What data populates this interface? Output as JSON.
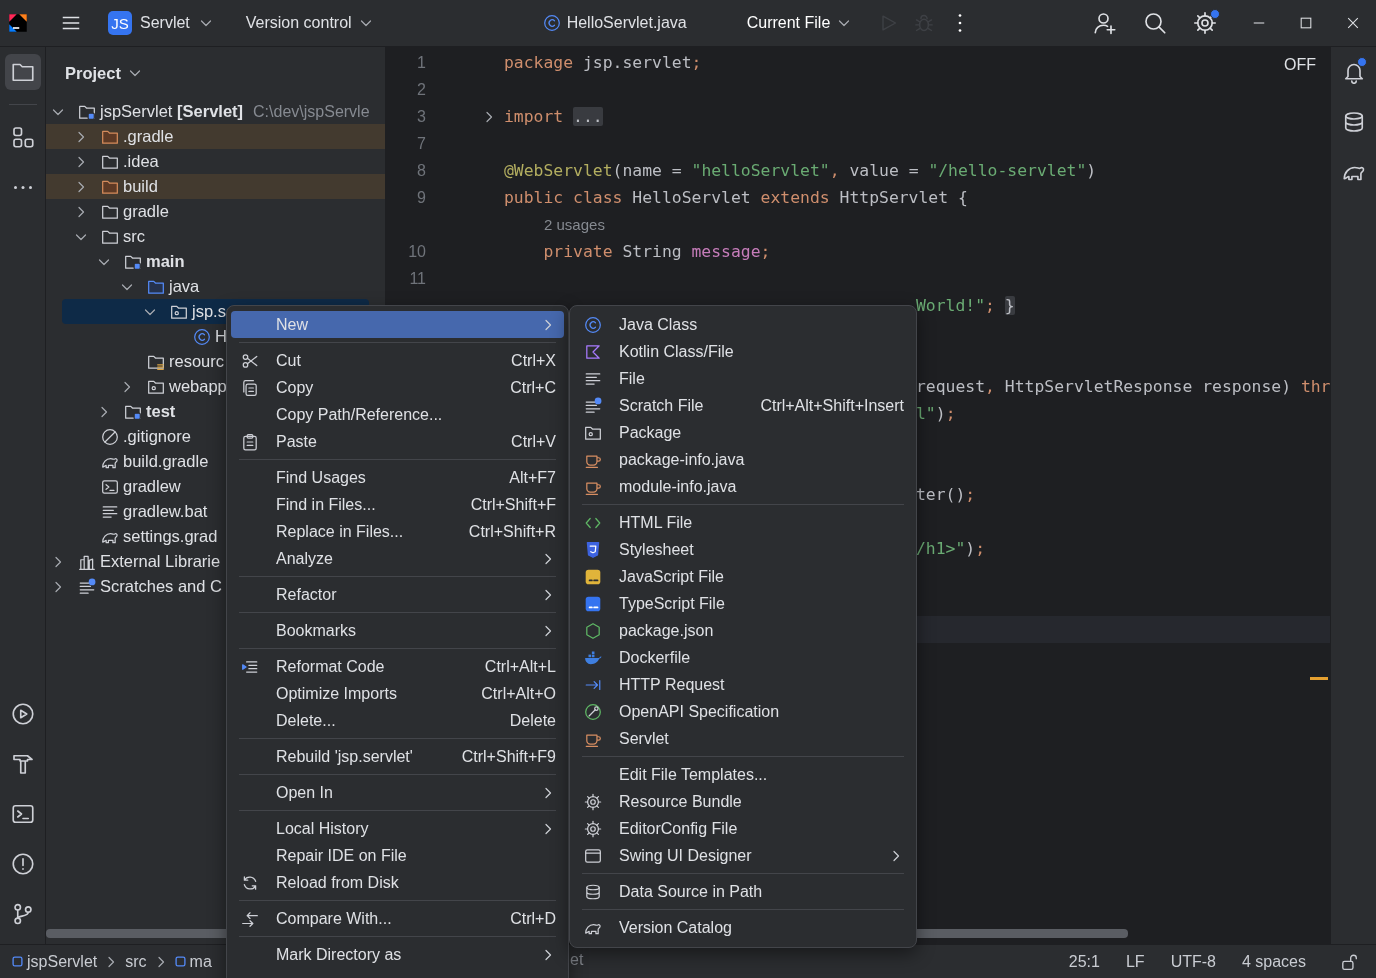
{
  "top_bar": {
    "project": {
      "badge": "JS",
      "name": "Servlet"
    },
    "vcs": "Version control",
    "file": "HelloServlet.java",
    "run_config": "Current File",
    "actions": [
      {
        "kind": "run",
        "disabled": true
      },
      {
        "kind": "debug",
        "disabled": true
      },
      {
        "kind": "more",
        "disabled": false
      }
    ],
    "tools": [
      {
        "kind": "add-user",
        "badge": false
      },
      {
        "kind": "search",
        "badge": false
      },
      {
        "kind": "settings",
        "badge": true
      }
    ]
  },
  "left_strip": {
    "top": [
      {
        "kind": "project",
        "selected": true
      },
      {
        "kind": "structure",
        "selected": false
      },
      {
        "kind": "more",
        "selected": false
      }
    ],
    "bottom": [
      {
        "kind": "services",
        "selected": false
      },
      {
        "kind": "build",
        "selected": false
      },
      {
        "kind": "terminal",
        "selected": false
      },
      {
        "kind": "problems",
        "selected": false
      },
      {
        "kind": "git",
        "selected": false
      }
    ]
  },
  "right_strip": [
    {
      "kind": "notifications",
      "badge": true
    },
    {
      "kind": "database",
      "badge": false
    },
    {
      "kind": "gradle",
      "badge": false
    }
  ],
  "project": {
    "title": "Project",
    "tree": [
      {
        "label": "jspServlet **[Servlet]**",
        "path": "C:\\dev\\jspServle",
        "kind": "module",
        "expanded": true,
        "selected": false,
        "excluded": false,
        "children": [
          {
            "label": ".gradle",
            "kind": "folder",
            "expanded": false,
            "selected": false,
            "excluded": true
          },
          {
            "label": ".idea",
            "kind": "folder",
            "expanded": false,
            "selected": false,
            "excluded": false
          },
          {
            "label": "build",
            "kind": "folder",
            "expanded": false,
            "selected": false,
            "excluded": true
          },
          {
            "label": "gradle",
            "kind": "folder",
            "expanded": false,
            "selected": false,
            "excluded": false
          },
          {
            "label": "src",
            "kind": "folder",
            "expanded": true,
            "selected": false,
            "excluded": false,
            "children": [
              {
                "label": "main",
                "kind": "source-set",
                "expanded": true,
                "selected": false,
                "excluded": false,
                "children": [
                  {
                    "label": "java",
                    "kind": "source-root",
                    "expanded": true,
                    "selected": false,
                    "excluded": false,
                    "children": [
                      {
                        "label": "jsp.s",
                        "kind": "package",
                        "expanded": true,
                        "selected": true,
                        "excluded": false,
                        "children": [
                          {
                            "label": "H",
                            "kind": "class",
                            "selected": false,
                            "excluded": false
                          }
                        ]
                      }
                    ]
                  },
                  {
                    "label": "resourc",
                    "kind": "resources",
                    "selected": false,
                    "excluded": false
                  },
                  {
                    "label": "webapp",
                    "kind": "package",
                    "expanded": false,
                    "selected": false,
                    "excluded": false
                  }
                ]
              },
              {
                "label": "test",
                "kind": "source-set",
                "expanded": false,
                "selected": false,
                "excluded": false
              }
            ]
          },
          {
            "label": ".gitignore",
            "kind": "gitignore",
            "selected": false,
            "excluded": false
          },
          {
            "label": "build.gradle",
            "kind": "gradle",
            "selected": false,
            "excluded": false
          },
          {
            "label": "gradlew",
            "kind": "terminal",
            "selected": false,
            "excluded": false
          },
          {
            "label": "gradlew.bat",
            "kind": "text",
            "selected": false,
            "excluded": false
          },
          {
            "label": "settings.grad",
            "kind": "gradle",
            "selected": false,
            "excluded": false
          }
        ]
      },
      {
        "label": "External Librarie",
        "kind": "library",
        "expanded": false,
        "selected": false,
        "excluded": false
      },
      {
        "label": "Scratches and C",
        "kind": "scratch",
        "expanded": false,
        "selected": false,
        "excluded": false
      }
    ]
  },
  "editor": {
    "mode": "OFF",
    "lines": [
      {
        "kind": "code",
        "number": "1",
        "tokens": [
          {
            "text": "package",
            "kind": "keyword"
          },
          {
            "text": " jsp.servlet",
            "kind": "plain"
          },
          {
            "text": ";",
            "kind": "keyword"
          }
        ]
      },
      {
        "kind": "code",
        "number": "2"
      },
      {
        "kind": "code",
        "number": "3",
        "folded": true,
        "tokens": [
          {
            "text": "import ",
            "kind": "keyword"
          },
          {
            "text": "...",
            "kind": "folded"
          }
        ]
      },
      {
        "kind": "code",
        "number": "7"
      },
      {
        "kind": "code",
        "number": "8",
        "tokens": [
          {
            "text": "@WebServlet",
            "kind": "annotation"
          },
          {
            "text": "(name = ",
            "kind": "plain"
          },
          {
            "text": "\"helloServlet\"",
            "kind": "string"
          },
          {
            "text": ", ",
            "kind": "keyword"
          },
          {
            "text": "value = ",
            "kind": "plain"
          },
          {
            "text": "\"/hello-servlet\"",
            "kind": "string"
          },
          {
            "text": ")",
            "kind": "plain"
          }
        ]
      },
      {
        "kind": "code",
        "number": "9",
        "tokens": [
          {
            "text": "public class ",
            "kind": "keyword"
          },
          {
            "text": "HelloServlet ",
            "kind": "plain"
          },
          {
            "text": "extends ",
            "kind": "keyword"
          },
          {
            "text": "HttpServlet {",
            "kind": "plain"
          }
        ]
      },
      {
        "kind": "hint",
        "text": "2 usages"
      },
      {
        "kind": "code",
        "number": "10",
        "tokens": [
          {
            "text": "    private ",
            "kind": "keyword"
          },
          {
            "text": "String ",
            "kind": "plain"
          },
          {
            "text": "message",
            "kind": "field"
          },
          {
            "text": ";",
            "kind": "keyword"
          }
        ]
      },
      {
        "kind": "code",
        "number": "11"
      },
      {
        "kind": "fragment",
        "tokens": [
          {
            "text": "World!\"",
            "kind": "string"
          },
          {
            "text": "; ",
            "kind": "keyword"
          },
          {
            "text": "}",
            "kind": "folded"
          }
        ]
      },
      {
        "kind": "covered"
      },
      {
        "kind": "covered"
      },
      {
        "kind": "fragment",
        "tokens": [
          {
            "text": "request",
            "kind": "plain"
          },
          {
            "text": ", ",
            "kind": "keyword"
          },
          {
            "text": "HttpServletResponse response) ",
            "kind": "plain"
          },
          {
            "text": "thr",
            "kind": "keyword"
          }
        ]
      },
      {
        "kind": "fragment",
        "tokens": [
          {
            "text": "l\"",
            "kind": "string"
          },
          {
            "text": ")",
            "kind": "plain"
          },
          {
            "text": ";",
            "kind": "keyword"
          }
        ]
      },
      {
        "kind": "covered"
      },
      {
        "kind": "covered"
      },
      {
        "kind": "fragment",
        "tokens": [
          {
            "text": "ter()",
            "kind": "plain"
          },
          {
            "text": ";",
            "kind": "keyword"
          }
        ]
      },
      {
        "kind": "covered"
      },
      {
        "kind": "fragment",
        "tokens": [
          {
            "text": "/h1>\"",
            "kind": "string"
          },
          {
            "text": ")",
            "kind": "plain"
          },
          {
            "text": ";",
            "kind": "keyword"
          }
        ]
      },
      {
        "kind": "covered"
      },
      {
        "kind": "covered"
      },
      {
        "kind": "covered",
        "current": true
      }
    ]
  },
  "menu": {
    "items": [
      {
        "kind": "item",
        "label": "New",
        "selected": true,
        "submenu": true
      },
      {
        "kind": "separator"
      },
      {
        "kind": "item",
        "label": "Cut",
        "shortcut": "Ctrl+X",
        "selected": false,
        "submenu": false
      },
      {
        "kind": "item",
        "label": "Copy",
        "shortcut": "Ctrl+C",
        "selected": false,
        "submenu": false
      },
      {
        "kind": "item",
        "label": "Copy Path/Reference...",
        "selected": false,
        "submenu": false
      },
      {
        "kind": "item",
        "label": "Paste",
        "shortcut": "Ctrl+V",
        "selected": false,
        "submenu": false
      },
      {
        "kind": "separator"
      },
      {
        "kind": "item",
        "label": "Find Usages",
        "shortcut": "Alt+F7",
        "selected": false,
        "submenu": false
      },
      {
        "kind": "item",
        "label": "Find in Files...",
        "shortcut": "Ctrl+Shift+F",
        "selected": false,
        "submenu": false
      },
      {
        "kind": "item",
        "label": "Replace in Files...",
        "shortcut": "Ctrl+Shift+R",
        "selected": false,
        "submenu": false
      },
      {
        "kind": "item",
        "label": "Analyze",
        "selected": false,
        "submenu": true
      },
      {
        "kind": "separator"
      },
      {
        "kind": "item",
        "label": "Refactor",
        "selected": false,
        "submenu": true
      },
      {
        "kind": "separator"
      },
      {
        "kind": "item",
        "label": "Bookmarks",
        "selected": false,
        "submenu": true
      },
      {
        "kind": "separator"
      },
      {
        "kind": "item",
        "label": "Reformat Code",
        "shortcut": "Ctrl+Alt+L",
        "selected": false,
        "submenu": false
      },
      {
        "kind": "item",
        "label": "Optimize Imports",
        "shortcut": "Ctrl+Alt+O",
        "selected": false,
        "submenu": false
      },
      {
        "kind": "item",
        "label": "Delete...",
        "shortcut": "Delete",
        "selected": false,
        "submenu": false
      },
      {
        "kind": "separator"
      },
      {
        "kind": "item",
        "label": "Rebuild 'jsp.servlet'",
        "shortcut": "Ctrl+Shift+F9",
        "selected": false,
        "submenu": false
      },
      {
        "kind": "separator"
      },
      {
        "kind": "item",
        "label": "Open In",
        "selected": false,
        "submenu": true
      },
      {
        "kind": "separator"
      },
      {
        "kind": "item",
        "label": "Local History",
        "selected": false,
        "submenu": true
      },
      {
        "kind": "item",
        "label": "Repair IDE on File",
        "selected": false,
        "submenu": false
      },
      {
        "kind": "item",
        "label": "Reload from Disk",
        "selected": false,
        "submenu": false
      },
      {
        "kind": "separator"
      },
      {
        "kind": "item",
        "label": "Compare With...",
        "shortcut": "Ctrl+D",
        "selected": false,
        "submenu": false
      },
      {
        "kind": "separator"
      },
      {
        "kind": "item",
        "label": "Mark Directory as",
        "selected": false,
        "submenu": true
      }
    ]
  },
  "submenu": {
    "items": [
      {
        "kind": "item",
        "label": "Java Class",
        "selected": false,
        "submenu": false
      },
      {
        "kind": "item",
        "label": "Kotlin Class/File",
        "selected": false,
        "submenu": false
      },
      {
        "kind": "item",
        "label": "File",
        "selected": false,
        "submenu": false
      },
      {
        "kind": "item",
        "label": "Scratch File",
        "shortcut": "Ctrl+Alt+Shift+Insert",
        "selected": false,
        "submenu": false
      },
      {
        "kind": "item",
        "label": "Package",
        "selected": false,
        "submenu": false
      },
      {
        "kind": "item",
        "label": "package-info.java",
        "selected": false,
        "submenu": false
      },
      {
        "kind": "item",
        "label": "module-info.java",
        "selected": false,
        "submenu": false
      },
      {
        "kind": "separator"
      },
      {
        "kind": "item",
        "label": "HTML File",
        "selected": false,
        "submenu": false
      },
      {
        "kind": "item",
        "label": "Stylesheet",
        "selected": false,
        "submenu": false
      },
      {
        "kind": "item",
        "label": "JavaScript File",
        "selected": false,
        "submenu": false
      },
      {
        "kind": "item",
        "label": "TypeScript File",
        "selected": false,
        "submenu": false
      },
      {
        "kind": "item",
        "label": "package.json",
        "selected": false,
        "submenu": false
      },
      {
        "kind": "item",
        "label": "Dockerfile",
        "selected": false,
        "submenu": false
      },
      {
        "kind": "item",
        "label": "HTTP Request",
        "selected": false,
        "submenu": false
      },
      {
        "kind": "item",
        "label": "OpenAPI Specification",
        "selected": false,
        "submenu": false
      },
      {
        "kind": "item",
        "label": "Servlet",
        "selected": false,
        "submenu": false
      },
      {
        "kind": "separator"
      },
      {
        "kind": "item",
        "label": "Edit File Templates...",
        "selected": false,
        "submenu": false
      },
      {
        "kind": "item",
        "label": "Resource Bundle",
        "selected": false,
        "submenu": false
      },
      {
        "kind": "item",
        "label": "EditorConfig File",
        "selected": false,
        "submenu": false
      },
      {
        "kind": "item",
        "label": "Swing UI Designer",
        "selected": false,
        "submenu": true
      },
      {
        "kind": "separator"
      },
      {
        "kind": "item",
        "label": "Data Source in Path",
        "selected": false,
        "submenu": false
      },
      {
        "kind": "separator"
      },
      {
        "kind": "item",
        "label": "Version Catalog",
        "selected": false,
        "submenu": false
      }
    ]
  },
  "status_bar": {
    "breadcrumbs": [
      {
        "label": "jspServlet",
        "kind": "module"
      },
      {
        "label": "src",
        "kind": "folder"
      },
      {
        "label": "ma",
        "kind": "module"
      }
    ],
    "hidden_crumb": "et",
    "position": "25:1",
    "line_separator": "LF",
    "encoding": "UTF-8",
    "indent": "4 spaces",
    "locked": false
  }
}
